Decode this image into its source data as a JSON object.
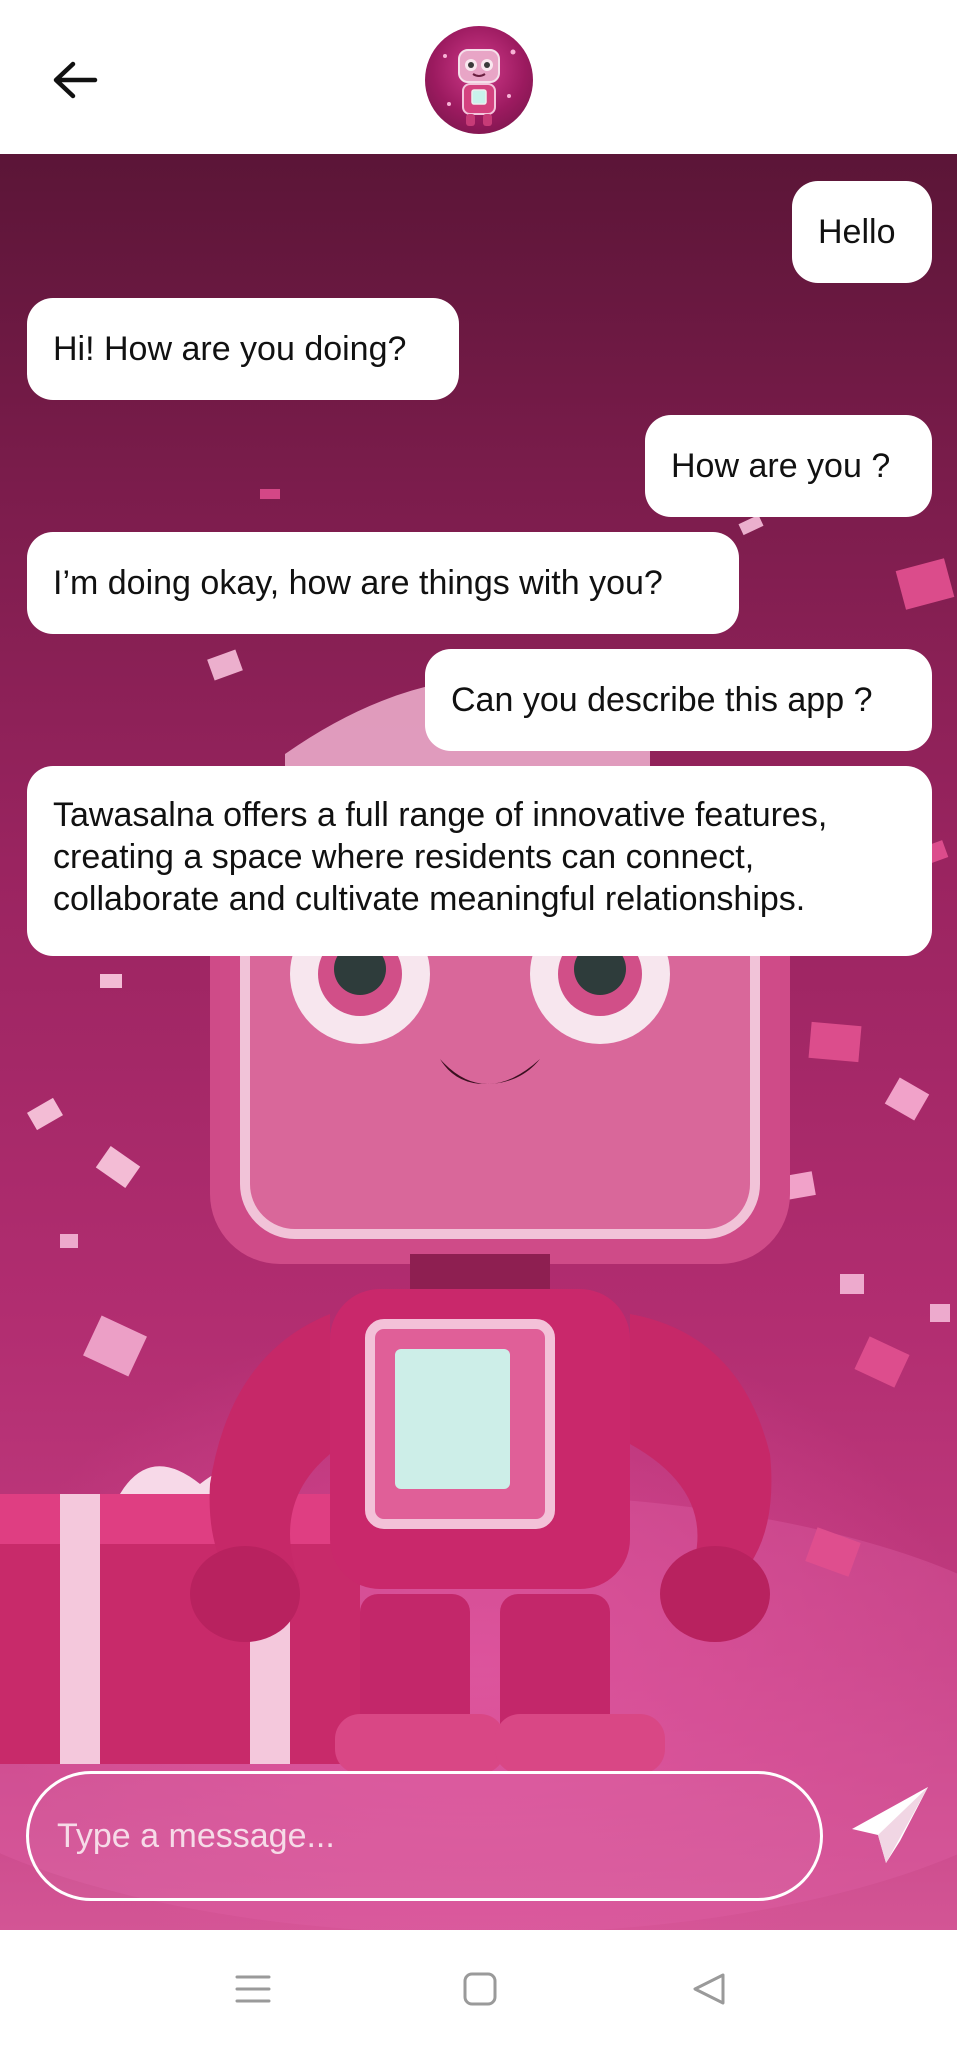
{
  "header": {
    "back_icon": "arrow-left-icon",
    "avatar_icon": "pink-robot-avatar"
  },
  "messages": [
    {
      "sender": "user",
      "text": "Hello"
    },
    {
      "sender": "bot",
      "text": "Hi! How are you doing?"
    },
    {
      "sender": "user",
      "text": "How are you ?"
    },
    {
      "sender": "bot",
      "text": "I’m doing okay, how are things with you?"
    },
    {
      "sender": "user",
      "text": "Can you describe this app ?"
    },
    {
      "sender": "bot",
      "lines": [
        "Tawasalna offers a full range of innovative features,",
        "creating a space where residents can connect,",
        "collaborate and cultivate meaningful relationships."
      ]
    }
  ],
  "composer": {
    "placeholder": "Type a message...",
    "value": "",
    "send_icon": "paper-plane-send-icon"
  },
  "navbar": {
    "recent_icon": "recent-apps-icon",
    "home_icon": "home-square-icon",
    "back_icon": "back-triangle-icon"
  },
  "colors": {
    "bubble_bg": "#ffffff",
    "bubble_text": "#111111",
    "chat_bg_top": "#5b1537",
    "chat_bg_bottom": "#d35595",
    "composer_border": "#ffffff"
  }
}
